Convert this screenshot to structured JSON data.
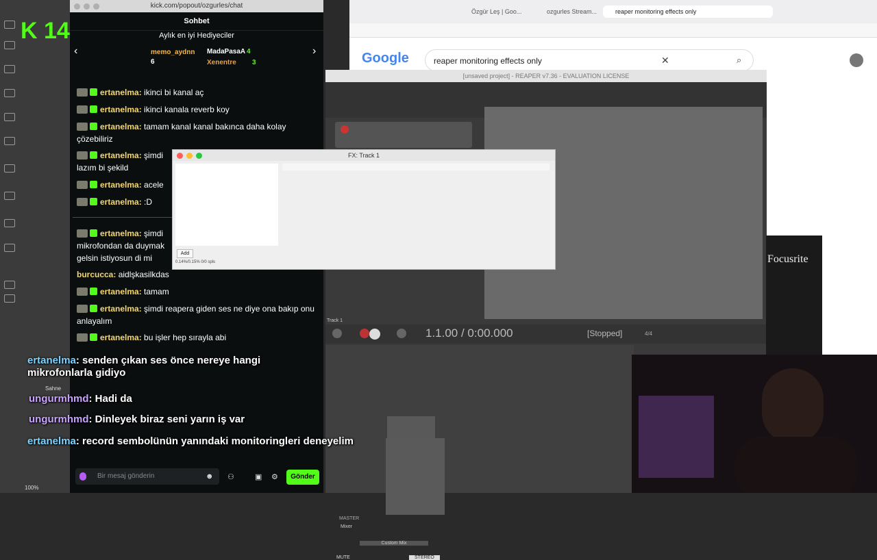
{
  "kick": {
    "url": "kick.com/popout/ozgurles/chat",
    "logo_text": "K 14",
    "header": "Sohbet",
    "gifters_title": "Aylık en iyi Hediyeciler",
    "gifters": [
      {
        "name": "memo_aydnn",
        "count": "6"
      },
      {
        "name": "MadaPasaA",
        "count": "4"
      },
      {
        "name": "Xenentre",
        "count": "3"
      }
    ],
    "messages": [
      {
        "user": "ertanelma:",
        "text": "ikinci bi kanal aç"
      },
      {
        "user": "ertanelma:",
        "text": "ikinci kanala reverb koy"
      },
      {
        "user": "ertanelma:",
        "text": "tamam kanal kanal bakınca daha kolay çözebiliriz"
      },
      {
        "user": "ertanelma:",
        "text": "şimdi"
      },
      {
        "user": "",
        "text": "lazım bi şekild"
      },
      {
        "user": "ertanelma:",
        "text": "acele"
      },
      {
        "user": "ertanelma:",
        "text": ":D"
      },
      {
        "user": "ertanelma:",
        "text": "şimdi"
      },
      {
        "user": "",
        "text": "mikrofondan da duymak"
      },
      {
        "user": "",
        "text": "gelsin istiyosun di mi"
      },
      {
        "user": "burcucca:",
        "text": "aidlşkasilkdas"
      },
      {
        "user": "ertanelma:",
        "text": "tamam"
      },
      {
        "user": "ertanelma:",
        "text": "şimdi reapera giden ses ne diye ona bakıp onu anlayalım"
      },
      {
        "user": "ertanelma:",
        "text": "bu işler hep sırayla abi"
      }
    ],
    "input_placeholder": "Bir mesaj gönderin",
    "send_label": "Gönder"
  },
  "overlay": [
    {
      "user": "ertanelma",
      "text": ": senden çıkan ses önce nereye hangi mikrofonlarla gidiyo"
    },
    {
      "user": "ungurmhmd",
      "text": ": Hadi da"
    },
    {
      "user": "ungurmhmd",
      "text": ": Dinleyek biraz seni yarın iş var"
    },
    {
      "user": "ertanelma",
      "text": ": record sembolünün yanındaki monitoringleri deneyelim"
    }
  ],
  "browser": {
    "tabs": [
      "Özgür Leş | Goo...",
      "ozgurles Stream...",
      "reaper monitoring effects only"
    ],
    "google": "Google",
    "query": "reaper monitoring effects only"
  },
  "reaper": {
    "title": "[unsaved project] - REAPER v7.36 - EVALUATION LICENSE",
    "time": "1.1.00 / 0:00.000",
    "status": "[Stopped]",
    "track_label": "Track 1",
    "timesig": "4/4",
    "mixer_label": "Mixer",
    "master_label": "MASTER",
    "custom_mix": "Custom Mix",
    "mute": "MUTE",
    "stereo": "STEREO"
  },
  "fx": {
    "title": "FX: Track 1",
    "add": "Add",
    "stats": "0.14%/0.15% 0/0 spls"
  },
  "focusrite": "Focusrite",
  "editor": {
    "zoom": "100%",
    "scene": "Sahne"
  }
}
